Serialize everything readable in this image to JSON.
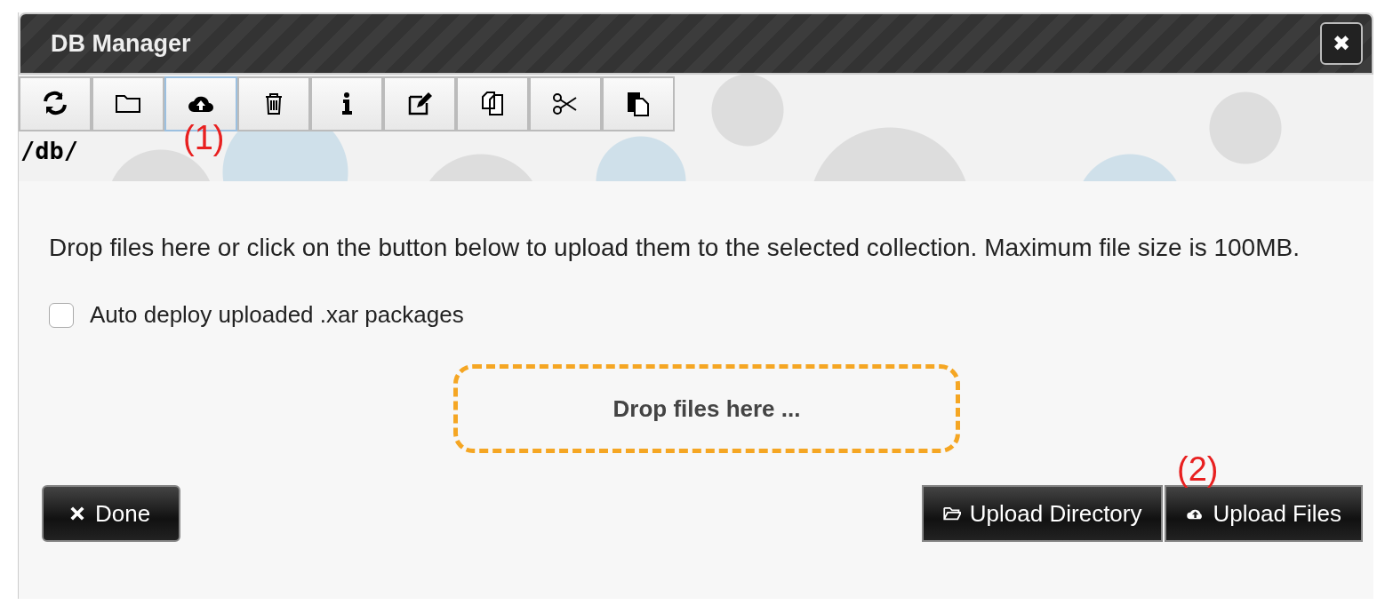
{
  "window": {
    "title": "DB Manager",
    "close_label": "✖"
  },
  "toolbar": [
    {
      "kind": "refresh",
      "selected": false
    },
    {
      "kind": "folder",
      "selected": false
    },
    {
      "kind": "upload",
      "selected": true
    },
    {
      "kind": "trash",
      "selected": false
    },
    {
      "kind": "info",
      "selected": false
    },
    {
      "kind": "edit",
      "selected": false
    },
    {
      "kind": "copy",
      "selected": false
    },
    {
      "kind": "cut",
      "selected": false
    },
    {
      "kind": "paste",
      "selected": false
    }
  ],
  "path": "/db/",
  "annotations": [
    "(1)",
    "(2)"
  ],
  "description": "Drop files here or click on the button below to upload them to the selected collection. Maximum file size is 100MB.",
  "auto_deploy": {
    "label": "Auto deploy uploaded .xar packages",
    "checked": false
  },
  "drop_zone": "Drop files here ...",
  "buttons": [
    {
      "kind": "done",
      "label": "Done"
    },
    {
      "kind": "directory",
      "label": "Upload Directory"
    },
    {
      "kind": "files",
      "label": "Upload Files"
    }
  ]
}
